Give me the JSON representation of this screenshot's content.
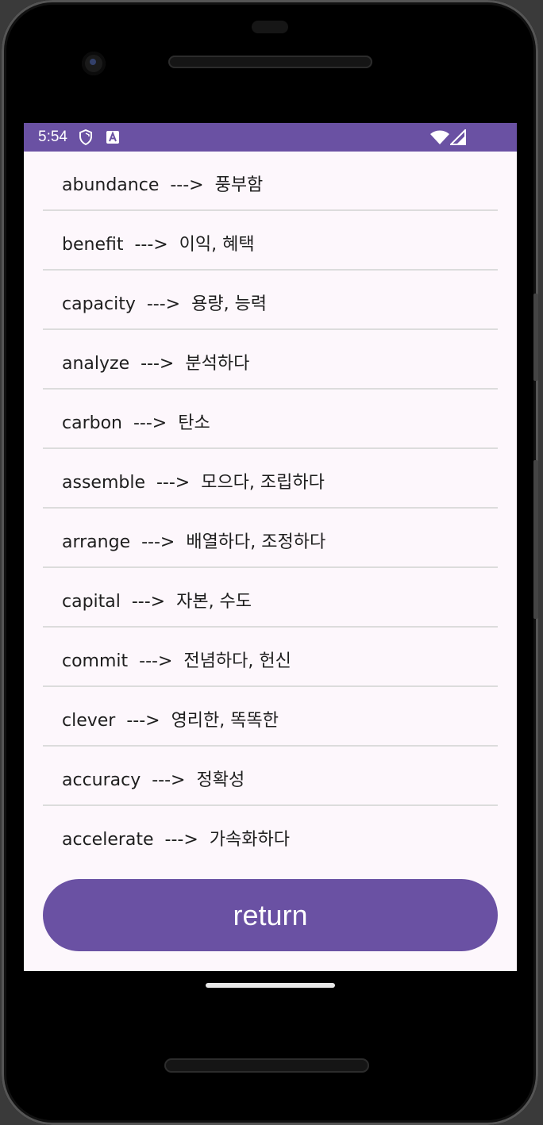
{
  "statusbar": {
    "time": "5:54",
    "icons": [
      "shield-icon",
      "a-icon",
      "wifi-icon",
      "signal-icon"
    ],
    "color": "#6a51a3"
  },
  "words": [
    {
      "text": "abundance  --->  풍부함"
    },
    {
      "text": "benefit  --->  이익, 혜택"
    },
    {
      "text": "capacity  --->  용량, 능력"
    },
    {
      "text": "analyze  --->  분석하다"
    },
    {
      "text": "carbon  --->  탄소"
    },
    {
      "text": "assemble  --->  모으다, 조립하다"
    },
    {
      "text": "arrange  --->  배열하다, 조정하다"
    },
    {
      "text": "capital  --->  자본, 수도"
    },
    {
      "text": "commit  --->  전념하다, 헌신"
    },
    {
      "text": "clever  --->  영리한, 똑똑한"
    },
    {
      "text": "accuracy  --->  정확성"
    },
    {
      "text": "accelerate  --->  가속화하다"
    }
  ],
  "return_button": {
    "label": "return",
    "color": "#6a51a3"
  },
  "background_color": "#fdf7fc"
}
